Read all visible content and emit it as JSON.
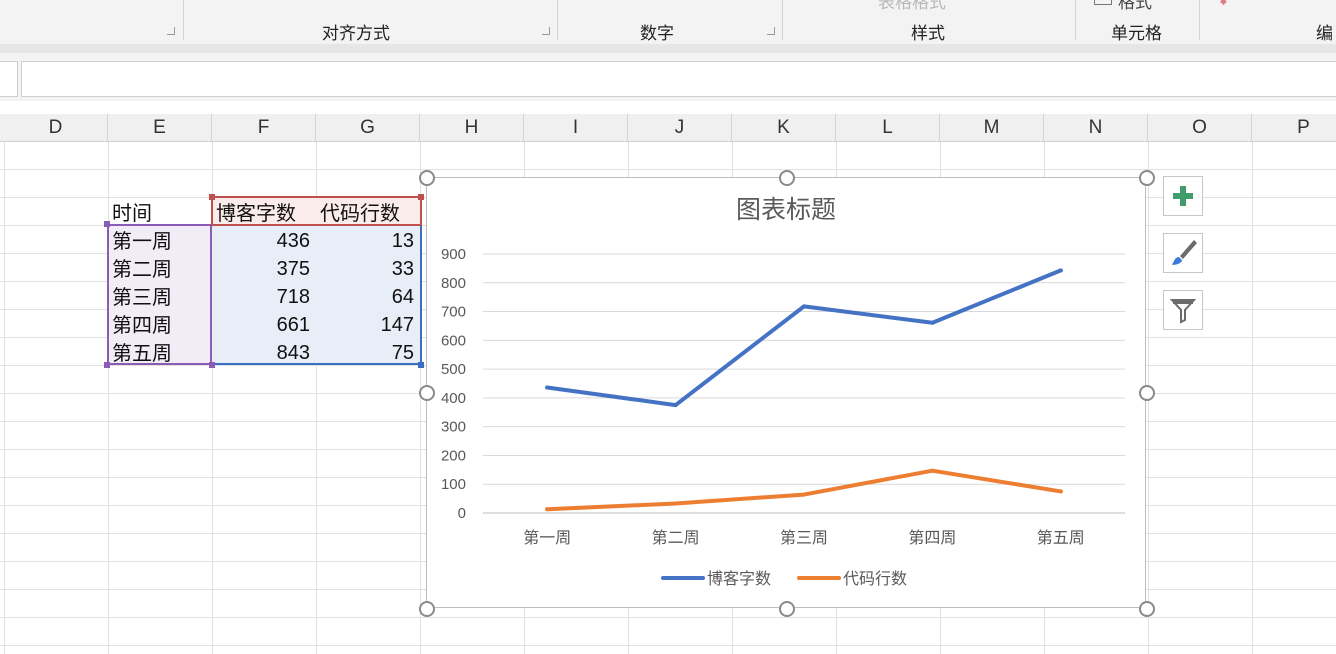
{
  "ribbon": {
    "groups": [
      "对齐方式",
      "数字",
      "样式",
      "单元格",
      "编"
    ],
    "partial_top": [
      "表格格式",
      "格式"
    ]
  },
  "columns": [
    "D",
    "E",
    "F",
    "G",
    "H",
    "I",
    "J",
    "K",
    "L",
    "M",
    "N",
    "O",
    "P"
  ],
  "table": {
    "header": [
      "时间",
      "博客字数",
      "代码行数"
    ],
    "rows": [
      {
        "label": "第一周",
        "blog": "436",
        "code": "13"
      },
      {
        "label": "第二周",
        "blog": "375",
        "code": "33"
      },
      {
        "label": "第三周",
        "blog": "718",
        "code": "64"
      },
      {
        "label": "第四周",
        "blog": "661",
        "code": "147"
      },
      {
        "label": "第五周",
        "blog": "843",
        "code": "75"
      }
    ]
  },
  "chart_data": {
    "type": "line",
    "title": "图表标题",
    "categories": [
      "第一周",
      "第二周",
      "第三周",
      "第四周",
      "第五周"
    ],
    "series": [
      {
        "name": "博客字数",
        "values": [
          436,
          375,
          718,
          661,
          843
        ],
        "color": "#4472c4"
      },
      {
        "name": "代码行数",
        "values": [
          13,
          33,
          64,
          147,
          75
        ],
        "color": "#ed7d31"
      }
    ],
    "ylim": [
      0,
      900
    ],
    "yticks": [
      0,
      100,
      200,
      300,
      400,
      500,
      600,
      700,
      800,
      900
    ],
    "grid": true,
    "legend": "bottom"
  },
  "chart_tools": [
    {
      "name": "chart-elements-button",
      "icon": "plus-icon"
    },
    {
      "name": "chart-styles-button",
      "icon": "brush-icon"
    },
    {
      "name": "chart-filters-button",
      "icon": "filter-icon"
    }
  ]
}
